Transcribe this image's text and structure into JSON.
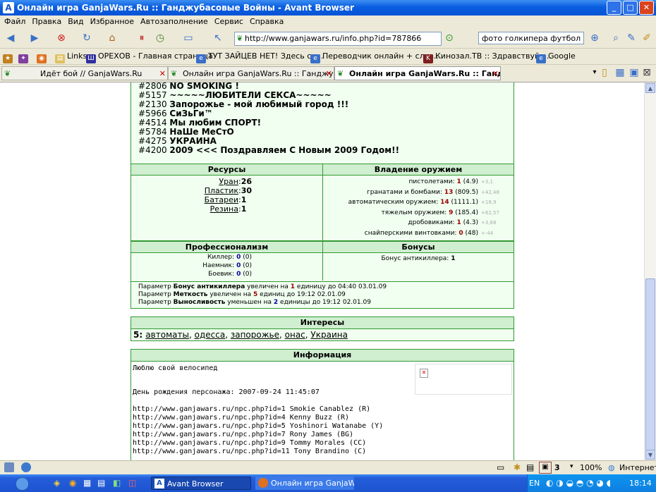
{
  "window": {
    "title": "Онлайн игра GanjaWars.Ru :: Ганджубасовые Войны - Avant Browser"
  },
  "menu": [
    "Файл",
    "Правка",
    "Вид",
    "Избранное",
    "Автозаполнение",
    "Сервис",
    "Справка"
  ],
  "address": {
    "url": "http://www.ganjawars.ru/info.php?id=787866"
  },
  "search": {
    "value": "фото голкипера футбол"
  },
  "links": [
    {
      "label": "Links",
      "icon": "folder-icon"
    },
    {
      "label": "ОРЕХОВ - Главная страница",
      "icon": "page-icon"
    },
    {
      "label": "ТУТ ЗАЙЦЕВ НЕТ! Здесь са...",
      "icon": "ie-icon"
    },
    {
      "label": "Переводчик онлайн + слов...",
      "icon": "ie-icon"
    },
    {
      "label": "Кинозал.ТВ :: Здравствуйт...",
      "icon": "k-icon"
    },
    {
      "label": "Google",
      "icon": "ie-icon"
    }
  ],
  "tabs": [
    {
      "label": "Идёт бой // GanjaWars.Ru",
      "active": false
    },
    {
      "label": "Онлайн игра GanjaWars.Ru :: Ганджубас...",
      "active": false
    },
    {
      "label": "Онлайн игра GanjaWars.Ru :: Ганджу...",
      "active": true
    }
  ],
  "syndicates": [
    {
      "id": "#2806",
      "name": "NO SMOKING !"
    },
    {
      "id": "#5157",
      "name": "~~~~~ЛЮБИТЕЛИ СЕКСА~~~~~"
    },
    {
      "id": "#2130",
      "name": "Запорожье - мой любимый город !!!"
    },
    {
      "id": "#5966",
      "name": "СиЗьГи™"
    },
    {
      "id": "#4514",
      "name": "Мы любим СПОРТ!"
    },
    {
      "id": "#5784",
      "name": "НаШе МеСтО"
    },
    {
      "id": "#4275",
      "name": "УКРАИНА"
    },
    {
      "id": "#4200",
      "name": "2009 <<< Поздравляем С Новым 2009 Годом!!"
    }
  ],
  "resources": {
    "title": "Ресурсы",
    "items": [
      {
        "name": "Уран",
        "value": "26"
      },
      {
        "name": "Пластик",
        "value": "30"
      },
      {
        "name": "Батареи",
        "value": "1"
      },
      {
        "name": "Резина",
        "value": "1"
      }
    ]
  },
  "weapons": {
    "title": "Владение оружием",
    "items": [
      {
        "name": "пистолетами:",
        "level": "1",
        "exp": "(4.9)",
        "delta": "+3,1"
      },
      {
        "name": "гранатами и бомбами:",
        "level": "13",
        "exp": "(809.5)",
        "delta": "+42,48"
      },
      {
        "name": "автоматическим оружием:",
        "level": "14",
        "exp": "(1111.1)",
        "delta": "+18,9"
      },
      {
        "name": "тяжелым оружием:",
        "level": "9",
        "exp": "(185.4)",
        "delta": "+62,57"
      },
      {
        "name": "дробовиками:",
        "level": "1",
        "exp": "(4.3)",
        "delta": "+3,68"
      },
      {
        "name": "снайперскими винтовками:",
        "level": "0",
        "exp": "(48)",
        "delta": "+-44"
      }
    ]
  },
  "profession": {
    "title": "Профессионализм",
    "items": [
      {
        "name": "Киллер:",
        "level": "0",
        "exp": "(0)"
      },
      {
        "name": "Наемник:",
        "level": "0",
        "exp": "(0)"
      },
      {
        "name": "Боевик:",
        "level": "0",
        "exp": "(0)"
      }
    ]
  },
  "bonuses": {
    "title": "Бонусы",
    "items": [
      {
        "name": "Бонус антикиллера:",
        "value": "1"
      }
    ]
  },
  "params": [
    {
      "pre": "Параметр ",
      "name": "Бонус антикиллера",
      "mid": " увеличен на ",
      "num": "1",
      "post": " единицу до 04:40 03.01.09",
      "color": "red"
    },
    {
      "pre": "Параметр ",
      "name": "Меткость",
      "mid": " увеличен на ",
      "num": "5",
      "post": " единиц до 19:12 02.01.09",
      "color": "red"
    },
    {
      "pre": "Параметр ",
      "name": "Выносливость",
      "mid": " уменьшен на ",
      "num": "2",
      "post": " единицы до 19:12 02.01.09",
      "color": "blue"
    }
  ],
  "interests": {
    "title": "Интересы",
    "count": "5:",
    "items": [
      "автоматы",
      "одесса",
      "запорожье",
      "онас",
      "Украина"
    ]
  },
  "info": {
    "title": "Информация",
    "about": "Люблю свой велосипед",
    "birthday": "День рождения персонажа: 2007-09-24 11:45:07",
    "npcs": [
      "http://www.ganjawars.ru/npc.php?id=1 Smokie Canablez (R)",
      "http://www.ganjawars.ru/npc.php?id=4 Kenny Buzz (R)",
      "http://www.ganjawars.ru/npc.php?id=5 Yoshinori Watanabe (Y)",
      "http://www.ganjawars.ru/npc.php?id=7 Rony James (BG)",
      "http://www.ganjawars.ru/npc.php?id=9 Tommy Morales (CC)",
      "http://www.ganjawars.ru/npc.php?id=11 Tony Brandino (C)"
    ]
  },
  "status": {
    "count": "3",
    "zoom": "100%",
    "zone": "Интернет"
  },
  "taskbar": {
    "tasks": [
      "Avant Browser",
      "Онлайн игра GanjaW..."
    ],
    "lang": "EN",
    "time": "18:14"
  },
  "colors": {
    "panel_border": "#339933",
    "panel_bg": "#f0fff0",
    "header_bg": "#d0eed0",
    "title_bar": "#0a5ee0"
  }
}
